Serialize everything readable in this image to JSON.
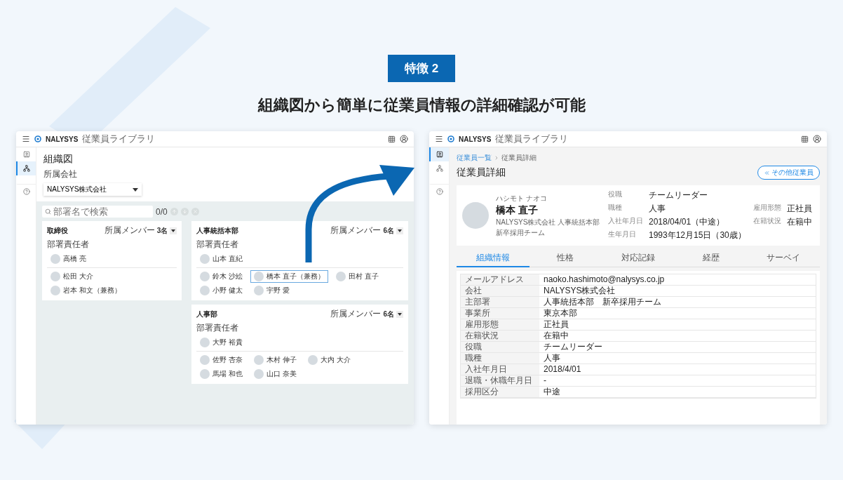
{
  "feature_badge": "特徴 2",
  "headline": "組織図から簡単に従業員情報の詳細確認が可能",
  "org_chart_screen": {
    "brand": "NALYSYS",
    "app_name": "従業員ライブラリ",
    "sidebar": [
      {
        "kind": "employee",
        "selected": false
      },
      {
        "kind": "org",
        "selected": true
      },
      {
        "kind": "help",
        "selected": false
      }
    ],
    "page_title": "組織図",
    "company_label": "所属会社",
    "company_value": "NALYSYS株式会社",
    "search_placeholder": "部署名で検索",
    "search_count": "0/0",
    "columns": [
      [
        {
          "name": "取締役",
          "member_label": "所属メンバー",
          "member_count": "3名",
          "leader_label": "部署責任者",
          "leader": "高橋 亮",
          "members": [
            {
              "name": "松田 大介",
              "selected": false
            },
            {
              "name": "岩本 和文（兼務）",
              "selected": false
            }
          ]
        }
      ],
      [
        {
          "name": "人事統括本部",
          "member_label": "所属メンバー",
          "member_count": "6名",
          "leader_label": "部署責任者",
          "leader": "山本 直紀",
          "members": [
            {
              "name": "鈴木 沙絵",
              "selected": false
            },
            {
              "name": "橋本 直子（兼務）",
              "selected": true
            },
            {
              "name": "田村 直子",
              "selected": false
            },
            {
              "name": "小野 健太",
              "selected": false
            },
            {
              "name": "宇野 愛",
              "selected": false
            }
          ]
        },
        {
          "name": "人事部",
          "member_label": "所属メンバー",
          "member_count": "6名",
          "leader_label": "部署責任者",
          "leader": "大野 裕貴",
          "members": [
            {
              "name": "佐野 杏奈",
              "selected": false
            },
            {
              "name": "木村 伸子",
              "selected": false
            },
            {
              "name": "大内 大介",
              "selected": false
            },
            {
              "name": "馬場 和也",
              "selected": false
            },
            {
              "name": "山口 奈美",
              "selected": false
            }
          ]
        }
      ]
    ]
  },
  "detail_screen": {
    "brand": "NALYSYS",
    "app_name": "従業員ライブラリ",
    "sidebar": [
      {
        "kind": "employee",
        "selected": true
      },
      {
        "kind": "org",
        "selected": false
      },
      {
        "kind": "help",
        "selected": false
      }
    ],
    "breadcrumb": [
      {
        "label": "従業員一覧"
      },
      {
        "label": "従業員詳細"
      }
    ],
    "page_title": "従業員詳細",
    "other_button": "その他従業員",
    "profile": {
      "kana": "ハシモト ナオコ",
      "name": "橋本 直子",
      "affiliation": "NALYSYS株式会社 人事統括本部",
      "team": "新卒採用チーム",
      "fields": [
        {
          "label": "役職",
          "value": "チームリーダー"
        },
        {
          "label": "職種",
          "value": "人事"
        },
        {
          "label": "入社年月日",
          "value": "2018/04/01（中途）"
        },
        {
          "label": "生年月日",
          "value": "1993年12月15日（30歳）"
        }
      ],
      "fields_2": [
        {
          "label": "雇用形態",
          "value": "正社員"
        },
        {
          "label": "在籍状況",
          "value": "在籍中"
        }
      ]
    },
    "tabs": [
      {
        "label": "組織情報",
        "selected": true
      },
      {
        "label": "性格",
        "selected": false
      },
      {
        "label": "対応記録",
        "selected": false
      },
      {
        "label": "経歴",
        "selected": false
      },
      {
        "label": "サーベイ",
        "selected": false
      }
    ],
    "table": [
      {
        "label": "メールアドレス",
        "value": "naoko.hashimoto@nalysys.co.jp"
      },
      {
        "label": "会社",
        "value": "NALYSYS株式会社"
      },
      {
        "label": "主部署",
        "value": "人事統括本部　新卒採用チーム"
      },
      {
        "label": "事業所",
        "value": "東京本部"
      },
      {
        "label": "雇用形態",
        "value": "正社員"
      },
      {
        "label": "在籍状況",
        "value": "在籍中"
      },
      {
        "label": "役職",
        "value": "チームリーダー"
      },
      {
        "label": "職種",
        "value": "人事"
      },
      {
        "label": "入社年月日",
        "value": "2018/4/01"
      },
      {
        "label": "退職・休職年月日",
        "value": "-"
      },
      {
        "label": "採用区分",
        "value": "中途"
      }
    ]
  }
}
